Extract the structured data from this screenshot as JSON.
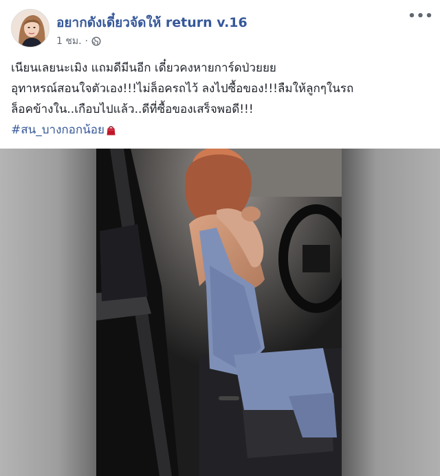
{
  "post": {
    "author": "อยากดังเดี๋ยวจัดให้ return v.16",
    "time": "1 ชม.",
    "separator": "·",
    "privacy_icon": "globe-icon",
    "more_icon": "more-options-icon",
    "more_label": "•••",
    "text_lines": [
      "เนียนเลยนะเมิง แถมดีมีนอีก เดี๋ยวคงหายการ์ดป่วยยย",
      "อุทาหรณ์สอนใจตัวเอง!!!ไม่ล็อครถไว้ ลงไปซื้อของ!!!ลืมให้ลูกๆในรถ",
      "ล็อคข้างใน..เกือบไปแล้ว..ดีที่ซื้อของเสร็จพอดี!!!"
    ],
    "hashtag": "#สน_บางกอกน้อย",
    "hashtag_emoji": "shopping-bag-icon",
    "colors": {
      "author": "#365899",
      "hashtag": "#365899",
      "meta": "#616770",
      "emoji": "#c0182a"
    }
  },
  "media": {
    "type": "video-thumbnail",
    "description_icon": "video-frame"
  }
}
